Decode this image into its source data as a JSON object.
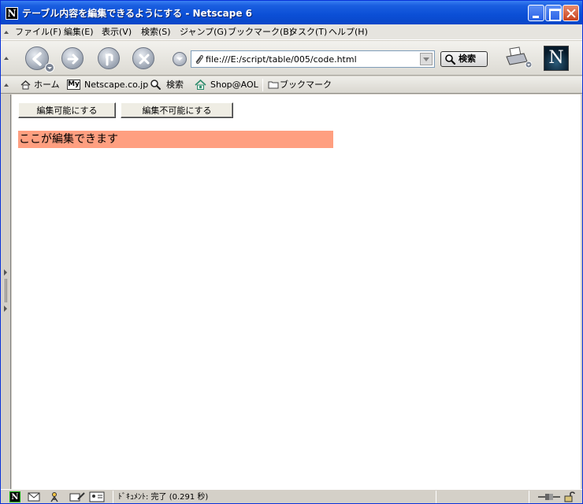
{
  "window": {
    "title": "テーブル内容を編集できるようにする - Netscape 6",
    "logo_letter": "N"
  },
  "menu": [
    {
      "label": "ファイル(F)"
    },
    {
      "label": "編集(E)"
    },
    {
      "label": "表示(V)"
    },
    {
      "label": "検索(S)"
    },
    {
      "label": "ジャンプ(G)"
    },
    {
      "label": "ブックマーク(B)"
    },
    {
      "label": "タスク(T)"
    },
    {
      "label": "ヘルプ(H)"
    }
  ],
  "navbar": {
    "url": "file:///E:/script/table/005/code.html",
    "search_label": "検索",
    "brand_logo": "N"
  },
  "personal_toolbar": {
    "items": [
      {
        "label": "ホーム",
        "icon": "home-icon"
      },
      {
        "label": "Netscape.co.jp",
        "icon": "my-netscape-icon",
        "badge": "My"
      },
      {
        "label": "検索",
        "icon": "search-icon"
      },
      {
        "label": "Shop@AOL",
        "icon": "shop-icon"
      },
      {
        "label": "ブックマーク",
        "icon": "bookmark-folder-icon"
      }
    ]
  },
  "page": {
    "enable_button": "編集可能にする",
    "disable_button": "編集不可能にする",
    "editable_cell": "ここが編集できます",
    "cell_color": "#ff9f80"
  },
  "statusbar": {
    "logo_letter": "N",
    "status_text": "ﾄﾞｷｭﾒﾝﾄ: 完了 (0.291 秒)"
  }
}
